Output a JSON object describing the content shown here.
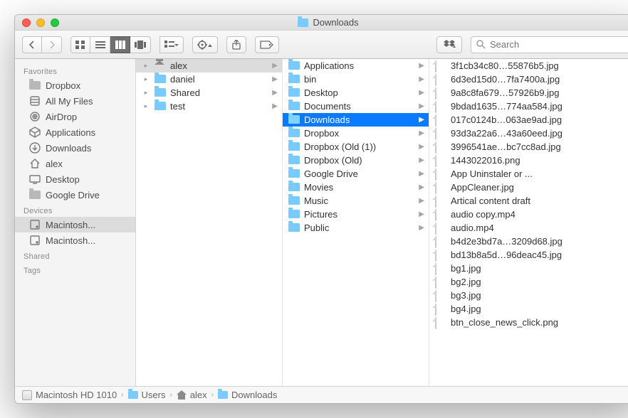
{
  "window": {
    "title": "Downloads"
  },
  "search": {
    "placeholder": "Search"
  },
  "sidebar": {
    "groups": [
      {
        "title": "Favorites",
        "items": [
          {
            "icon": "folder",
            "label": "Dropbox"
          },
          {
            "icon": "all",
            "label": "All My Files"
          },
          {
            "icon": "airdrop",
            "label": "AirDrop"
          },
          {
            "icon": "apps",
            "label": "Applications"
          },
          {
            "icon": "download",
            "label": "Downloads"
          },
          {
            "icon": "home",
            "label": "alex"
          },
          {
            "icon": "desktop",
            "label": "Desktop"
          },
          {
            "icon": "folder",
            "label": "Google Drive"
          }
        ]
      },
      {
        "title": "Devices",
        "items": [
          {
            "icon": "disk",
            "label": "Macintosh...",
            "selected": true
          },
          {
            "icon": "disk",
            "label": "Macintosh..."
          }
        ]
      },
      {
        "title": "Shared",
        "items": []
      },
      {
        "title": "Tags",
        "items": []
      }
    ]
  },
  "columns": [
    {
      "items": [
        {
          "type": "home",
          "label": "alex",
          "nav": true,
          "sel": "dim"
        },
        {
          "type": "folder",
          "label": "daniel",
          "nav": true
        },
        {
          "type": "folder",
          "label": "Shared",
          "nav": true
        },
        {
          "type": "folder",
          "label": "test",
          "nav": true
        }
      ]
    },
    {
      "items": [
        {
          "type": "folder",
          "label": "Applications",
          "nav": true
        },
        {
          "type": "folder",
          "label": "bin",
          "nav": true
        },
        {
          "type": "folder",
          "label": "Desktop",
          "nav": true
        },
        {
          "type": "folder",
          "label": "Documents",
          "nav": true
        },
        {
          "type": "folder",
          "label": "Downloads",
          "nav": true,
          "sel": "active"
        },
        {
          "type": "folder",
          "label": "Dropbox",
          "nav": true
        },
        {
          "type": "folder",
          "label": "Dropbox (Old (1))",
          "nav": true
        },
        {
          "type": "folder",
          "label": "Dropbox (Old)",
          "nav": true
        },
        {
          "type": "folder",
          "label": "Google Drive",
          "nav": true
        },
        {
          "type": "folder",
          "label": "Movies",
          "nav": true
        },
        {
          "type": "folder",
          "label": "Music",
          "nav": true
        },
        {
          "type": "folder",
          "label": "Pictures",
          "nav": true
        },
        {
          "type": "folder",
          "label": "Public",
          "nav": true
        }
      ]
    },
    {
      "items": [
        {
          "type": "file",
          "label": "3f1cb34c80…55876b5.jpg"
        },
        {
          "type": "file",
          "label": "6d3ed15d0…7fa7400a.jpg"
        },
        {
          "type": "file",
          "label": "9a8c8fa679…57926b9.jpg"
        },
        {
          "type": "file",
          "label": "9bdad1635…774aa584.jpg"
        },
        {
          "type": "file",
          "label": "017c0124b…063ae9ad.jpg"
        },
        {
          "type": "file",
          "label": "93d3a22a6…43a60eed.jpg"
        },
        {
          "type": "file",
          "label": "3996541ae…bc7cc8ad.jpg"
        },
        {
          "type": "file",
          "label": "1443022016.png"
        },
        {
          "type": "file",
          "label": "App Uninstaler or ..."
        },
        {
          "type": "file",
          "label": "AppCleaner.jpg"
        },
        {
          "type": "file",
          "label": "Artical content draft"
        },
        {
          "type": "file",
          "label": "audio copy.mp4"
        },
        {
          "type": "file",
          "label": "audio.mp4"
        },
        {
          "type": "file",
          "label": "b4d2e3bd7a…3209d68.jpg"
        },
        {
          "type": "file",
          "label": "bd13b8a5d…96deac45.jpg"
        },
        {
          "type": "file",
          "label": "bg1.jpg"
        },
        {
          "type": "file",
          "label": "bg2.jpg"
        },
        {
          "type": "file",
          "label": "bg3.jpg"
        },
        {
          "type": "file",
          "label": "bg4.jpg"
        },
        {
          "type": "file",
          "label": "btn_close_news_click.png"
        }
      ]
    }
  ],
  "pathbar": [
    {
      "icon": "disk",
      "label": "Macintosh HD 1010"
    },
    {
      "icon": "folder",
      "label": "Users"
    },
    {
      "icon": "home",
      "label": "alex"
    },
    {
      "icon": "folder",
      "label": "Downloads"
    }
  ]
}
